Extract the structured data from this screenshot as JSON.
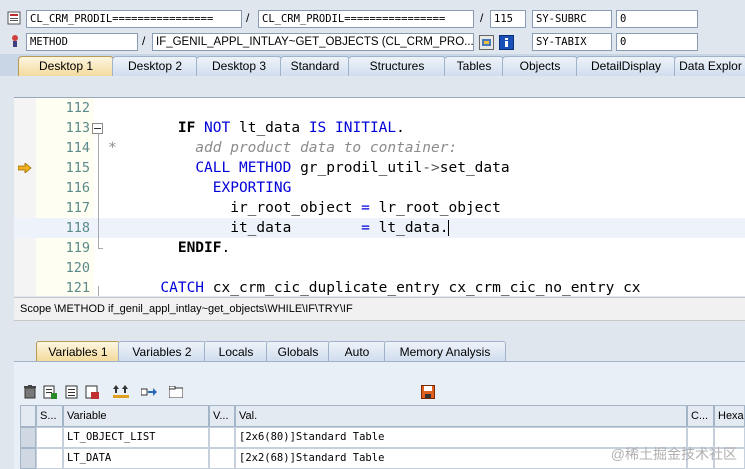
{
  "header": {
    "program_left": "CL_CRM_PRODIL================",
    "program_right": "CL_CRM_PRODIL================",
    "line_no": "115",
    "sy_subrc_label": "SY-SUBRC",
    "sy_subrc_value": "0",
    "event_type": "METHOD",
    "event_name": "IF_GENIL_APPL_INTLAY~GET_OBJECTS (CL_CRM_PRO...",
    "sy_tabix_label": "SY-TABIX",
    "sy_tabix_value": "0",
    "slash": "/"
  },
  "tabs": [
    "Desktop 1",
    "Desktop 2",
    "Desktop 3",
    "Standard",
    "Structures",
    "Tables",
    "Objects",
    "DetailDisplay",
    "Data Explor"
  ],
  "code_lines": [
    {
      "num": "112",
      "text": ""
    },
    {
      "num": "113",
      "text": "    IF NOT lt_data IS INITIAL."
    },
    {
      "num": "114",
      "text": "*     add product data to container:"
    },
    {
      "num": "115",
      "text": "      CALL METHOD gr_prodil_util->set_data"
    },
    {
      "num": "116",
      "text": "        EXPORTING"
    },
    {
      "num": "117",
      "text": "          ir_root_object = lr_root_object"
    },
    {
      "num": "118",
      "text": "          it_data        = lt_data."
    },
    {
      "num": "119",
      "text": "    ENDIF."
    },
    {
      "num": "120",
      "text": ""
    },
    {
      "num": "121",
      "text": "  CATCH cx_crm_cic_duplicate_entry cx_crm_cic_no_entry cx"
    }
  ],
  "scope": "Scope \\METHOD if_genil_appl_intlay~get_objects\\WHILE\\IF\\TRY\\IF",
  "var_tabs": [
    "Variables 1",
    "Variables 2",
    "Locals",
    "Globals",
    "Auto",
    "Memory Analysis"
  ],
  "grid": {
    "headers": [
      "S...",
      "Variable",
      "V...",
      "Val.",
      "C...",
      "Hexa"
    ],
    "rows": [
      {
        "variable": "LT_OBJECT_LIST",
        "value": "[2x6(80)]Standard Table"
      },
      {
        "variable": "LT_DATA",
        "value": "[2x2(68)]Standard Table"
      }
    ]
  },
  "watermark": "@稀土掘金技术社区",
  "colors": {
    "accent_tab": "#f3d99a",
    "keyword": "#0000d8",
    "comment": "#8c8c8c"
  }
}
